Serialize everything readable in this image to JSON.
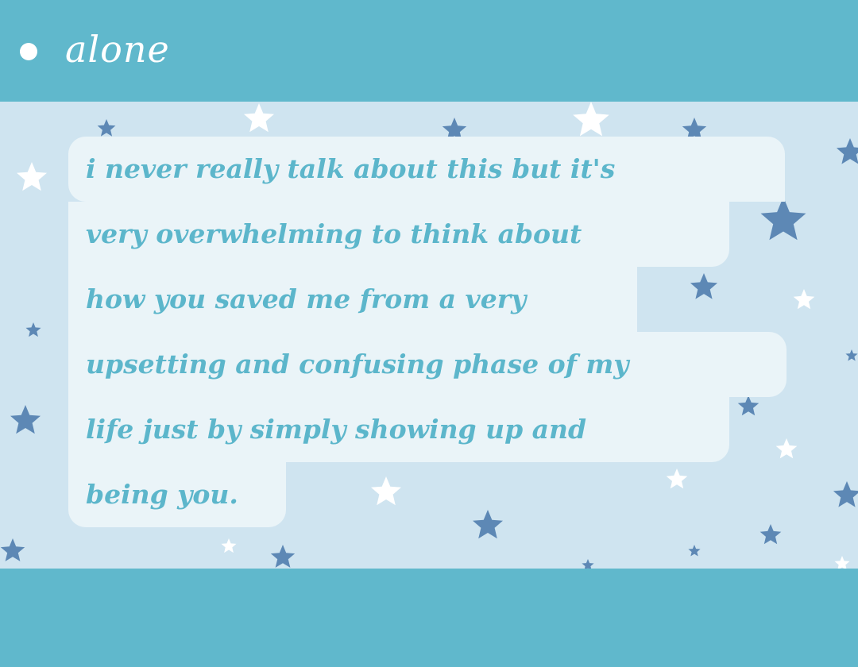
{
  "header": {
    "title": "alone"
  },
  "caption": {
    "lines": [
      "i never really talk about this but it's",
      "very overwhelming to think about",
      "how you saved me from a very",
      "upsetting and confusing phase of my",
      "life just by simply showing up and",
      "being you."
    ]
  },
  "colors": {
    "teal_band": "#60b8cc",
    "star_background": "#cfe4f0",
    "caption_bubble": "#eaf4f8",
    "caption_text": "#5cb6cb",
    "title_text": "#ffffff",
    "star_blue": "#5d88b5",
    "star_white": "#ffffff"
  }
}
